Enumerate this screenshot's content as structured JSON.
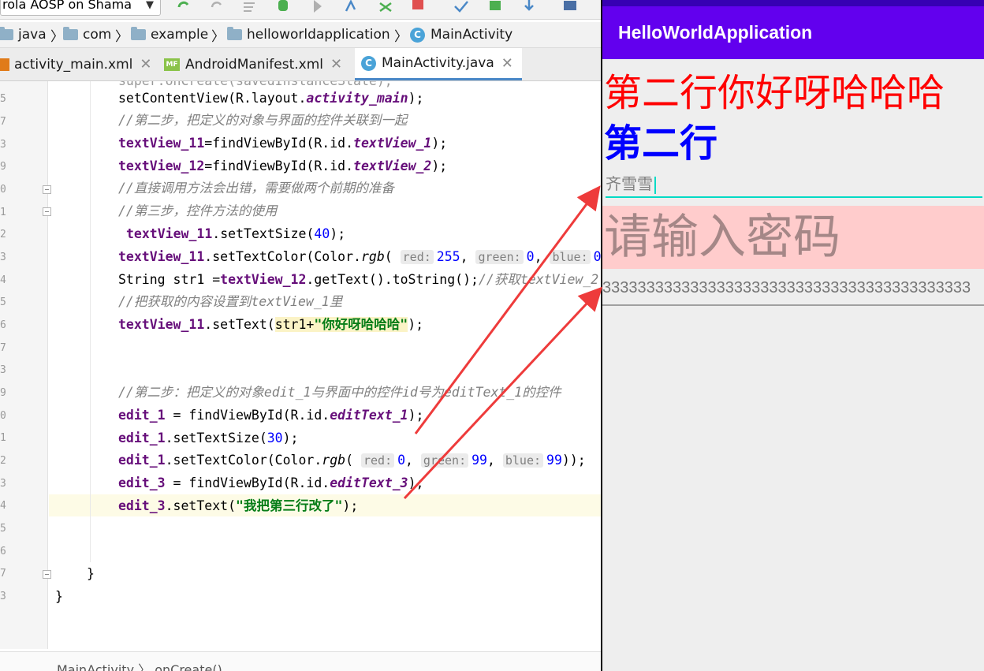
{
  "ide": {
    "device_selector": "rola AOSP on Shama",
    "breadcrumb": [
      "java",
      "com",
      "example",
      "helloworldapplication",
      "MainActivity"
    ],
    "tabs": [
      {
        "label": "activity_main.xml",
        "active": false
      },
      {
        "label": "AndroidManifest.xml",
        "active": false
      },
      {
        "label": "MainActivity.java",
        "active": true
      }
    ],
    "line_numbers": [
      "5",
      "7",
      "3",
      "9",
      "0",
      "1",
      "2",
      "3",
      "4",
      "5",
      "6",
      "7",
      "3",
      "9",
      "0",
      "1",
      "2",
      "3",
      "4",
      "5",
      "6",
      "7",
      "3"
    ],
    "status_path": [
      "MainActivity",
      "onCreate()"
    ]
  },
  "code": {
    "l1": {
      "a": "setContentView(R.layout.",
      "b": "activity_main",
      "c": ");"
    },
    "l2": "//第二步，把定义的对象与界面的控件关联到一起",
    "l3": {
      "a": "textView_11",
      "b": "=findViewById(R.id.",
      "c": "textView_1",
      "d": ");"
    },
    "l4": {
      "a": "textView_12",
      "b": "=findViewById(R.id.",
      "c": "textView_2",
      "d": ");"
    },
    "l5": "//直接调用方法会出错，需要做两个前期的准备",
    "l6": "//第三步，控件方法的使用",
    "l7": {
      "a": "textView_11",
      "b": ".setTextSize(",
      "c": "40",
      "d": ");"
    },
    "l8": {
      "a": "textView_11",
      "b": ".setTextColor(Color.",
      "c": "rgb",
      "d": "(",
      "h1": "red:",
      "v1": "255",
      "h2": "green:",
      "v2": "0",
      "h3": "blue:",
      "v3": "0",
      "e": ")"
    },
    "l9": {
      "a": "String str1 =",
      "b": "textView_12",
      "c": ".getText().toString();",
      "d": "//获取textView_2"
    },
    "l10": "//把获取的内容设置到textView_1里",
    "l11": {
      "a": "textView_11",
      "b": ".setText(",
      "c": "str1+",
      "d": "\"你好呀哈哈哈\"",
      "e": ");"
    },
    "l12": "//第二步：把定义的对象edit_1与界面中的控件id号为editText_1的控件",
    "l13": {
      "a": "edit_1",
      "b": " = findViewById(R.id.",
      "c": "editText_1",
      "d": ");"
    },
    "l14": {
      "a": "edit_1",
      "b": ".setTextSize(",
      "c": "30",
      "d": ");"
    },
    "l15": {
      "a": "edit_1",
      "b": ".setTextColor(Color.",
      "c": "rgb",
      "d": "(",
      "h1": "red:",
      "v1": "0",
      "h2": "green:",
      "v2": "99",
      "h3": "blue:",
      "v3": "99",
      "e": "));"
    },
    "l16": {
      "a": "edit_3",
      "b": " = findViewById(R.id.",
      "c": "editText_3",
      "d": ");"
    },
    "l17": {
      "a": "edit_3",
      "b": ".setText(",
      "c": "\"我把第三行改了\"",
      "d": ");"
    },
    "l18": "}",
    "l19": "}"
  },
  "app": {
    "title": "HelloWorldApplication",
    "text_view_1": "第二行你好呀哈哈哈",
    "text_view_2": "第二行",
    "edit_text_1": "齐雪雪",
    "edit_text_2_hint": "请输入密码",
    "edit_text_3": "333333333333333333333333333333333333333333"
  },
  "colors": {
    "app_bar": "#6200ee",
    "status_bar": "#3700b3",
    "text_view_1": "#ff0000",
    "text_view_2": "#0000ff",
    "edit_text_2_bg": "#ffcccc",
    "annotation_arrow": "#ee3b3b"
  }
}
